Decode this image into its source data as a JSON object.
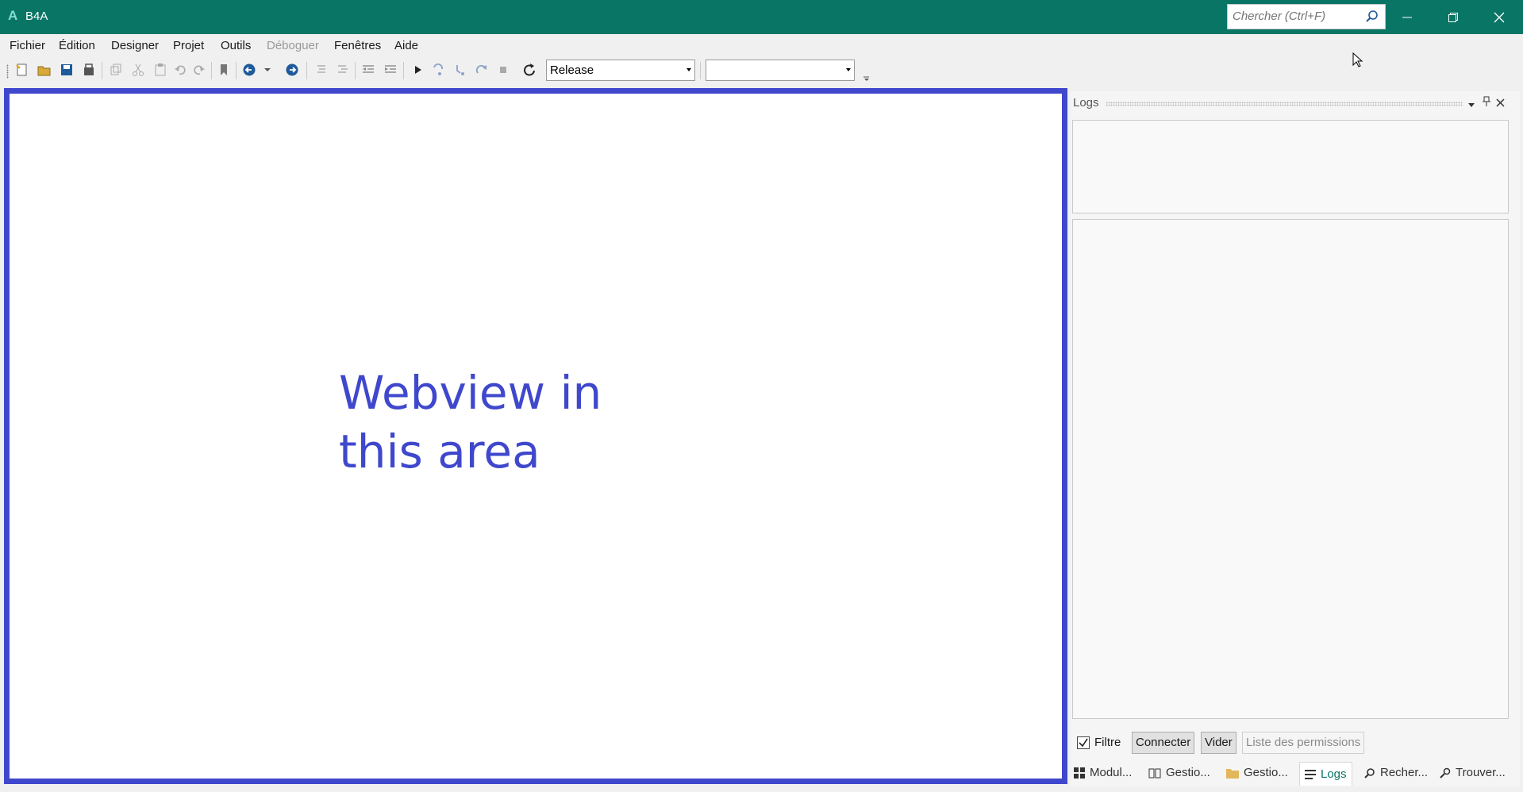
{
  "window": {
    "title": "B4A",
    "logo": "A"
  },
  "search": {
    "placeholder": "Chercher (Ctrl+F)"
  },
  "menu": {
    "items": [
      {
        "label": "Fichier",
        "enabled": true
      },
      {
        "label": "Édition",
        "enabled": true
      },
      {
        "label": "Designer",
        "enabled": true
      },
      {
        "label": "Projet",
        "enabled": true
      },
      {
        "label": "Outils",
        "enabled": true
      },
      {
        "label": "Déboguer",
        "enabled": false
      },
      {
        "label": "Fenêtres",
        "enabled": true
      },
      {
        "label": "Aide",
        "enabled": true
      }
    ]
  },
  "toolbar": {
    "build_config": "Release",
    "device": ""
  },
  "webview": {
    "line1": "Webview in",
    "line2": "this area",
    "border_color": "#3f48cc"
  },
  "logs": {
    "title": "Logs",
    "filter_label": "Filtre",
    "filter_checked": true,
    "connect_label": "Connecter",
    "clear_label": "Vider",
    "permissions_label": "Liste des permissions"
  },
  "bottom_tabs": [
    {
      "label": "Modul...",
      "icon": "modules-icon"
    },
    {
      "label": "Gestio...",
      "icon": "book-icon"
    },
    {
      "label": "Gestio...",
      "icon": "folder-icon"
    },
    {
      "label": "Logs",
      "icon": "logs-icon",
      "active": true
    },
    {
      "label": "Recher...",
      "icon": "search-icon"
    },
    {
      "label": "Trouver...",
      "icon": "find-icon"
    }
  ],
  "colors": {
    "titlebar": "#087565",
    "accent": "#3f48cc"
  }
}
